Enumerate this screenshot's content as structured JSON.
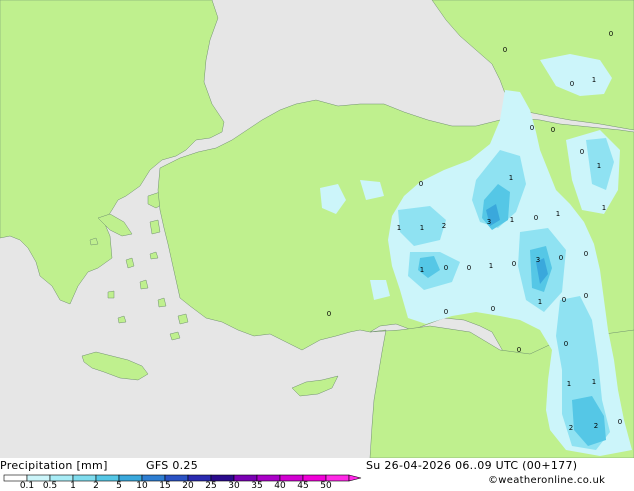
{
  "header": {
    "title": "Precipitation [mm]",
    "model": "GFS 0.25",
    "valid_time": "Su 26-04-2026 06..09 UTC (00+177)",
    "credit": "©weatheronline.co.uk"
  },
  "legend": {
    "ticks": [
      "0.1",
      "0.5",
      "1",
      "2",
      "5",
      "10",
      "15",
      "20",
      "25",
      "30",
      "35",
      "40",
      "45",
      "50"
    ],
    "colors": [
      "#ffffff",
      "#ccf5fa",
      "#a8ecf6",
      "#7fdcee",
      "#55c7e6",
      "#3aa8dc",
      "#2e7ed2",
      "#2a52c4",
      "#2a2ab0",
      "#2a0a8c",
      "#7a00b4",
      "#aa00c8",
      "#d200d2",
      "#f000d8",
      "#ff28e6"
    ]
  },
  "colors": {
    "sea": "#e6e6e6",
    "land": "#bff08e",
    "precip_light": "#ccf5fa",
    "precip_mid": "#8fe2f2",
    "precip_high": "#55c7e6",
    "precip_max": "#3aa8dc"
  },
  "map_values": [
    "0",
    "0",
    "1",
    "0",
    "0",
    "0",
    "0",
    "1",
    "0",
    "1",
    "1",
    "1",
    "1",
    "2",
    "3",
    "1",
    "0",
    "1",
    "1",
    "0",
    "0",
    "1",
    "0",
    "3",
    "0",
    "0",
    "1",
    "0",
    "0",
    "0",
    "0",
    "0",
    "1",
    "1",
    "2",
    "2",
    "0",
    "0",
    "0"
  ]
}
